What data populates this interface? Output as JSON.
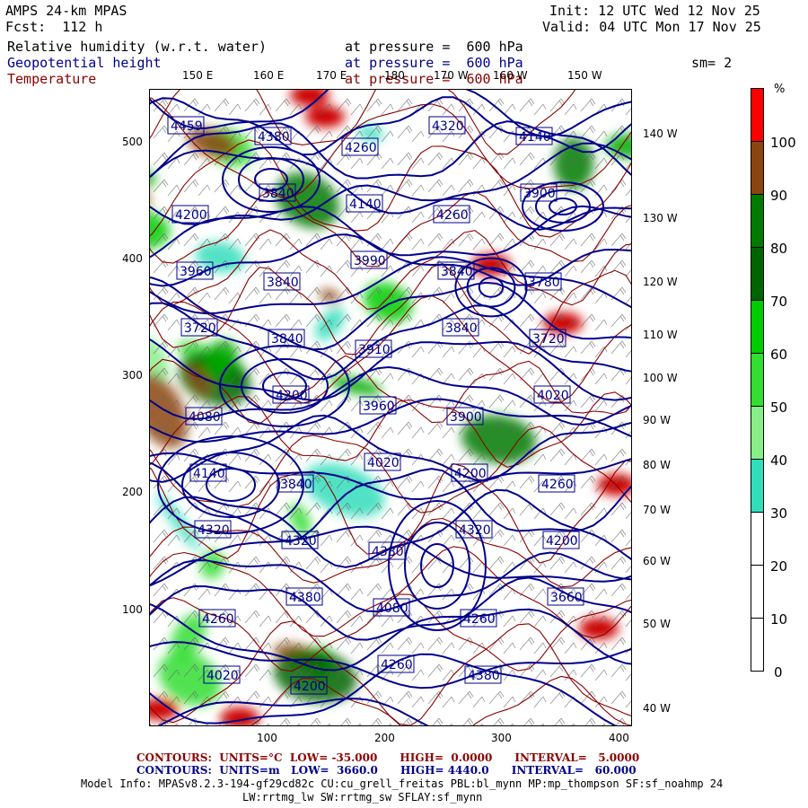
{
  "header": {
    "model": "AMPS 24-km MPAS",
    "fcst": "Fcst:  112 h",
    "init": "Init: 12 UTC Wed 12 Nov 25",
    "valid": "Valid: 04 UTC Mon 17 Nov 25",
    "sm": "sm= 2",
    "fields": [
      {
        "name": "Relative humidity (w.r.t. water)",
        "pressure": "at pressure =  600 hPa",
        "color": "#000000"
      },
      {
        "name": "Geopotential height",
        "pressure": "at pressure =  600 hPa",
        "color": "#00008b"
      },
      {
        "name": "Temperature",
        "pressure": "at pressure =  600 hPa",
        "color": "#8b0000"
      }
    ]
  },
  "map": {
    "top_lon_labels": [
      "150 E",
      "160 E",
      "170 E",
      "180",
      "170 W",
      "160 W",
      "150 W"
    ],
    "right_lon_labels": [
      "140 W",
      "130 W",
      "120 W",
      "110 W",
      "100 W",
      "90 W",
      "80 W",
      "70 W",
      "60 W",
      "50 W",
      "40 W"
    ],
    "x_ticks": [
      "100",
      "200",
      "300",
      "400"
    ],
    "y_ticks": [
      "500",
      "400",
      "300",
      "200",
      "100"
    ],
    "height_labels": [
      "4459",
      "4380",
      "4260",
      "4320",
      "4140",
      "4200",
      "3840",
      "4140",
      "4260",
      "3900",
      "3960",
      "3840",
      "3990",
      "3840",
      "3780",
      "3720",
      "3840",
      "3910",
      "3840",
      "3720",
      "4080",
      "4200",
      "3960",
      "3900",
      "4020",
      "4140",
      "3840",
      "4020",
      "4200",
      "4260",
      "4320",
      "4320",
      "4380",
      "4320",
      "4200",
      "4260",
      "4380",
      "4080",
      "4260",
      "3660",
      "4020",
      "4200",
      "4260",
      "4380"
    ]
  },
  "colorbar": {
    "unit": "%",
    "labels": [
      "100",
      "90",
      "80",
      "70",
      "60",
      "50",
      "40",
      "30",
      "20",
      "10",
      "0"
    ],
    "bands": [
      {
        "from": 100,
        "to": 110,
        "color": "#ff0000"
      },
      {
        "from": 90,
        "to": 100,
        "color": "#8b4513"
      },
      {
        "from": 80,
        "to": 90,
        "color": "#007a00"
      },
      {
        "from": 70,
        "to": 80,
        "color": "#006400"
      },
      {
        "from": 60,
        "to": 70,
        "color": "#00cc00"
      },
      {
        "from": 50,
        "to": 60,
        "color": "#33dd33"
      },
      {
        "from": 40,
        "to": 50,
        "color": "#88ee88"
      },
      {
        "from": 30,
        "to": 40,
        "color": "#33ddbb"
      },
      {
        "from": 20,
        "to": 30,
        "color": "#ffffff"
      },
      {
        "from": 10,
        "to": 20,
        "color": "#ffffff"
      },
      {
        "from": 0,
        "to": 10,
        "color": "#ffffff"
      }
    ]
  },
  "footer": {
    "temp_contours": "CONTOURS:  UNITS=°C  LOW= -35.000      HIGH=  0.0000      INTERVAL=   5.0000",
    "height_contours": "CONTOURS:  UNITS=m   LOW=  3660.0      HIGH= 4440.0      INTERVAL=   60.000",
    "model_info_1": "Model Info: MPASv8.2.3-194-gf29cd82c CU:cu_grell_freitas PBL:bl_mynn MP:mp_thompson SF:sf_noahmp 24",
    "model_info_2": "LW:rrtmg_lw SW:rrtmg_sw SFLAY:sf_mynn"
  },
  "colors": {
    "height": "#00008b",
    "temperature": "#8b0000"
  }
}
